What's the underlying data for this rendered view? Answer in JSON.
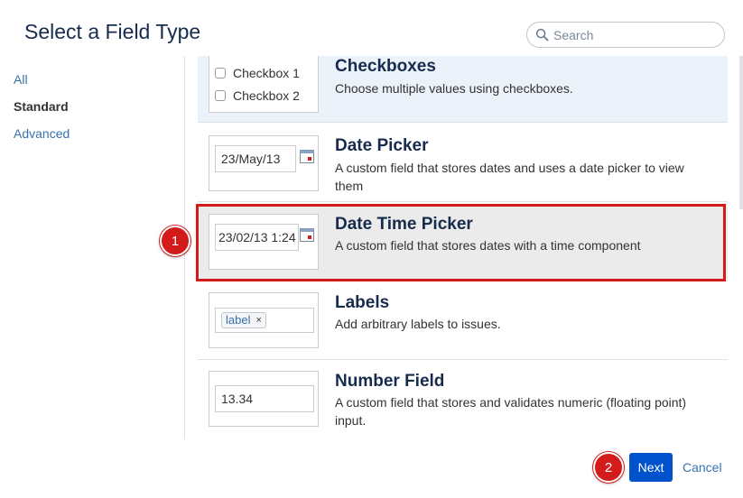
{
  "dialog": {
    "title": "Select a Field Type"
  },
  "search": {
    "placeholder": "Search",
    "icon": "search-icon"
  },
  "nav": {
    "items": [
      {
        "label": "All",
        "active": false
      },
      {
        "label": "Standard",
        "active": true
      },
      {
        "label": "Advanced",
        "active": false
      }
    ]
  },
  "fields": [
    {
      "title": "Checkboxes",
      "description": "Choose multiple values using checkboxes.",
      "preview": {
        "option1": "Checkbox 1",
        "option2": "Checkbox 2"
      }
    },
    {
      "title": "Date Picker",
      "description": "A custom field that stores dates and uses a date picker to view them",
      "preview": {
        "value": "23/May/13",
        "icon": "calendar-icon"
      }
    },
    {
      "title": "Date Time Picker",
      "description": "A custom field that stores dates with a time component",
      "preview": {
        "value": "23/02/13 1:24",
        "icon": "calendar-icon"
      },
      "selected": true
    },
    {
      "title": "Labels",
      "description": "Add arbitrary labels to issues.",
      "preview": {
        "tag": "label",
        "remove": "×"
      }
    },
    {
      "title": "Number Field",
      "description": "A custom field that stores and validates numeric (floating point) input.",
      "preview": {
        "value": "13.34"
      }
    }
  ],
  "annotations": {
    "step1": "1",
    "step2": "2",
    "color": "#d31b1b"
  },
  "footer": {
    "next_label": "Next",
    "cancel_label": "Cancel"
  },
  "colors": {
    "primary_button": "#0052cc",
    "link": "#3572b0",
    "selected_row": "#ebebeb",
    "first_row": "#ebf2f9"
  }
}
